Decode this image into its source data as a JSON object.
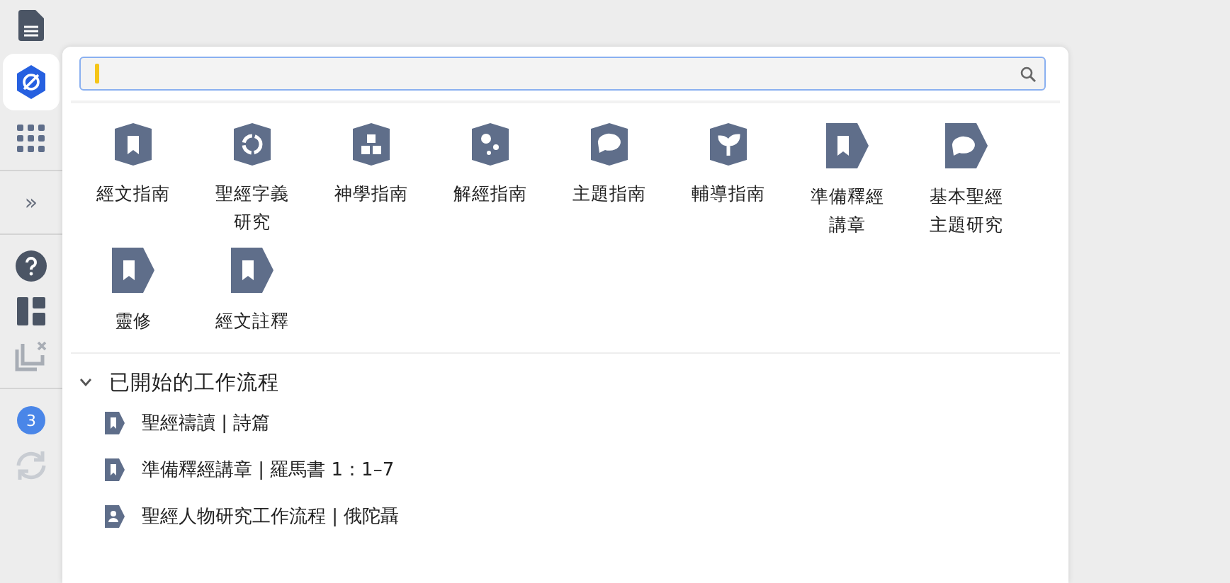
{
  "sidebar": {
    "items": [
      {
        "kind": "document",
        "selected": false
      },
      {
        "kind": "shield",
        "selected": true
      },
      {
        "kind": "apps",
        "selected": false
      },
      {
        "kind": "expand",
        "label": "»",
        "selected": false
      },
      {
        "kind": "help",
        "selected": false
      },
      {
        "kind": "layout",
        "selected": false
      },
      {
        "kind": "closeall",
        "selected": false
      },
      {
        "kind": "badge",
        "label": "3",
        "selected": false
      },
      {
        "kind": "sync",
        "selected": false
      }
    ]
  },
  "tiles": [
    {
      "kind": "bookmark",
      "label": "經文指南"
    },
    {
      "kind": "cycle",
      "label": "聖經字義研究"
    },
    {
      "kind": "blocks",
      "label": "神學指南"
    },
    {
      "kind": "bubbles",
      "label": "解經指南"
    },
    {
      "kind": "speech",
      "label": "主題指南"
    },
    {
      "kind": "sprout",
      "label": "輔導指南"
    },
    {
      "kind": "tagbookmark",
      "label": "準備釋經講章"
    },
    {
      "kind": "tagspeech",
      "label": "基本聖經主題研究"
    },
    {
      "kind": "tagbookmark",
      "label": "靈修"
    },
    {
      "kind": "tagbookmark",
      "label": "經文註釋"
    }
  ],
  "section": {
    "title": "已開始的工作流程",
    "expanded": true,
    "items": [
      {
        "kind": "bookmark",
        "label": "聖經禱讀 | 詩篇"
      },
      {
        "kind": "bookmark",
        "label": "準備釋經講章 | 羅馬書 1：1–7"
      },
      {
        "kind": "person",
        "label": "聖經人物研究工作流程 | 俄陀聶"
      }
    ]
  }
}
